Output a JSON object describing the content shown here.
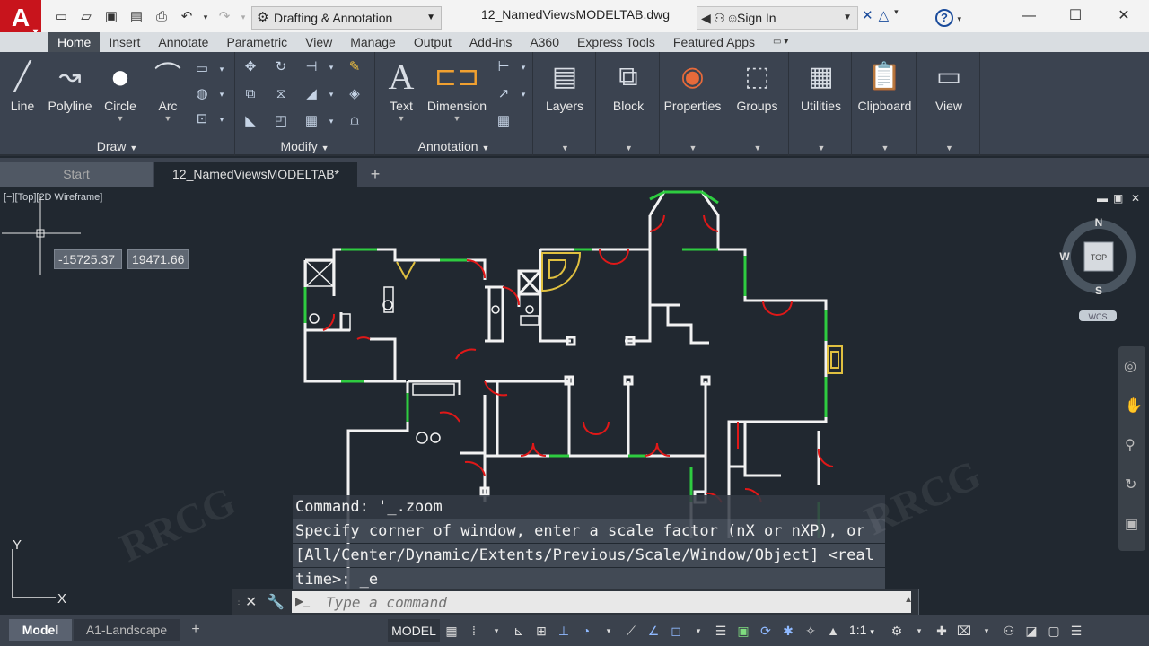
{
  "app": {
    "logo": "A",
    "logo_menu": "▾"
  },
  "titlebar": {
    "workspace": "Drafting & Annotation",
    "document": "12_NamedViewsMODELTAB.dwg",
    "sign_in": "Sign In",
    "help": "?"
  },
  "ribbon_tabs": [
    "Home",
    "Insert",
    "Annotate",
    "Parametric",
    "View",
    "Manage",
    "Output",
    "Add-ins",
    "A360",
    "Express Tools",
    "Featured Apps"
  ],
  "ribbon": {
    "draw": {
      "title": "Draw",
      "tools": [
        "Line",
        "Polyline",
        "Circle",
        "Arc"
      ]
    },
    "modify": {
      "title": "Modify"
    },
    "annotation": {
      "title": "Annotation",
      "tools": [
        "Text",
        "Dimension"
      ]
    },
    "big_tools": [
      "Layers",
      "Block",
      "Properties",
      "Groups",
      "Utilities",
      "Clipboard",
      "View"
    ]
  },
  "doc_tabs": {
    "start": "Start",
    "current": "12_NamedViewsMODELTAB*"
  },
  "viewport": {
    "label": "[−][Top][2D Wireframe]",
    "coord_x": "-15725.37",
    "coord_y": "19471.66",
    "viewcube": {
      "n": "N",
      "s": "S",
      "w": "W",
      "top": "TOP",
      "wcs": "WCS"
    }
  },
  "command": {
    "history": [
      "Command: '_.zoom",
      "Specify corner of window, enter a scale factor (nX or nXP), or",
      "[All/Center/Dynamic/Extents/Previous/Scale/Window/Object] <real",
      "time>: _e"
    ],
    "placeholder": "Type a command"
  },
  "ucs": {
    "x": "X",
    "y": "Y"
  },
  "status": {
    "model_tab": "Model",
    "layout_tab": "A1-Landscape",
    "model_space": "MODEL",
    "scale": "1:1"
  },
  "colors": {
    "accent_red": "#c8141c",
    "wall_white": "#f2f2f2",
    "wall_green": "#2ecc40",
    "door_red": "#e01818",
    "fixture_yellow": "#e0c040"
  }
}
